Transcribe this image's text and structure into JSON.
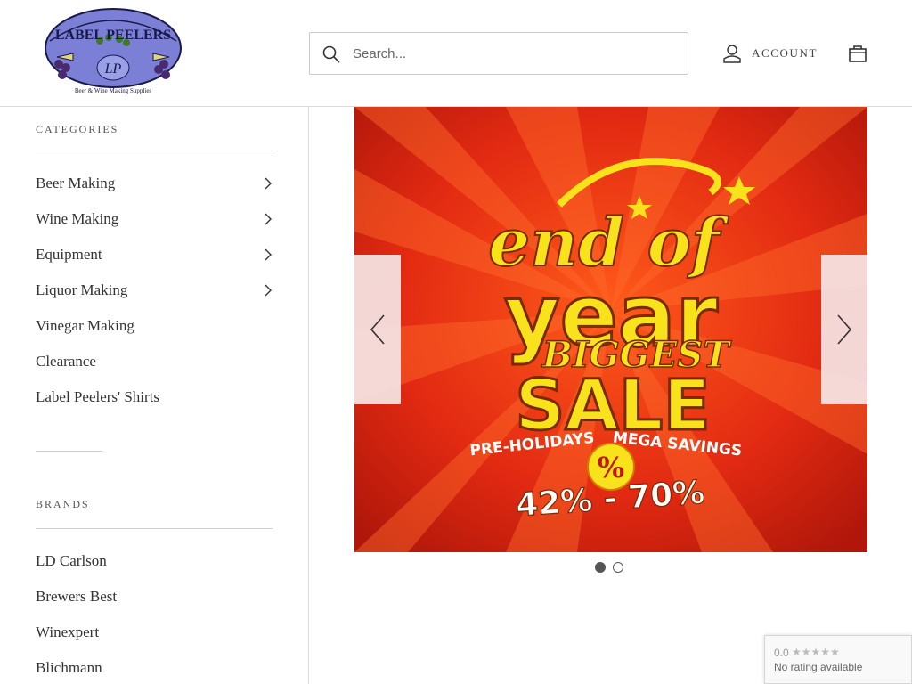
{
  "header": {
    "logo_text": "LABEL PEELERS",
    "logo_monogram": "LP",
    "logo_tagline": "Beer & Wine Making Supplies",
    "search_placeholder": "Search...",
    "account_label": "ACCOUNT"
  },
  "sidebar": {
    "categories_title": "CATEGORIES",
    "categories": [
      {
        "label": "Beer Making",
        "has_children": true
      },
      {
        "label": "Wine Making",
        "has_children": true
      },
      {
        "label": "Equipment",
        "has_children": true
      },
      {
        "label": "Liquor Making",
        "has_children": true
      },
      {
        "label": "Vinegar Making",
        "has_children": false
      },
      {
        "label": "Clearance",
        "has_children": false
      },
      {
        "label": "Label Peelers' Shirts",
        "has_children": false
      }
    ],
    "brands_title": "BRANDS",
    "brands": [
      {
        "label": "LD Carlson"
      },
      {
        "label": "Brewers Best"
      },
      {
        "label": "Winexpert"
      },
      {
        "label": "Blichmann"
      }
    ]
  },
  "slideshow": {
    "line1": "end of",
    "line2": "year",
    "line3": "BIGGEST",
    "line4": "SALE",
    "ribbon_left": "PRE-HOLIDAYS",
    "ribbon_right": "MEGA SAVINGS",
    "percent_symbol": "%",
    "discount": "42% - 70%",
    "slide_count": 2,
    "active_slide": 1
  },
  "badge": {
    "score": "0.0",
    "stars": "★★★★★",
    "text": "No rating available"
  },
  "colors": {
    "sale_red": "#e22a12",
    "sale_yellow": "#f7e21b",
    "logo_purple": "#7b7fd6"
  }
}
